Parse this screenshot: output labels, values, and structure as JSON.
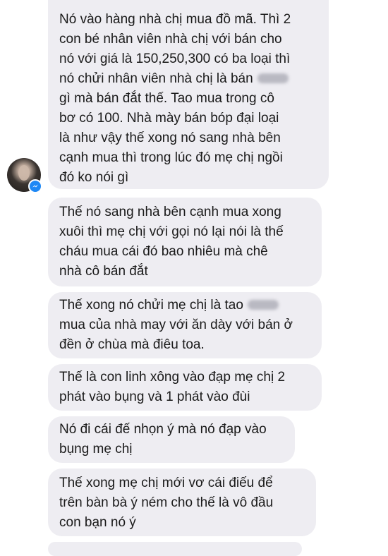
{
  "messages": [
    {
      "lines": [
        "Nó vào hàng nhà chị mua đồ mã. Thì 2",
        "con bé nhân viên nhà chị với bán cho",
        "nó với giá là 150,250,300 có ba loại thì",
        "nó chửi nhân viên nhà chị là bán",
        "gì mà bán đắt thế. Tao mua trong cô",
        "bơ có 100. Nhà mày bán bóp đại loại",
        "là như vậy thế xong nó sang nhà bên",
        "cạnh mua thì trong lúc đó mẹ chị ngồi",
        "đó ko nói gì"
      ]
    },
    {
      "lines": [
        "Thế nó sang nhà bên cạnh mua xong",
        "xuôi thì mẹ chị với gọi nó lại nói là thế",
        "cháu mua cái đó bao nhiêu mà chê",
        "nhà cô bán đắt"
      ]
    },
    {
      "lines": [
        "Thế xong nó chửi mẹ chị là tao",
        "mua của nhà may với ăn dày với bán ở",
        "đền ở chùa mà điêu toa."
      ]
    },
    {
      "lines": [
        "Thế là con linh xông vào đạp mẹ chị 2",
        "phát vào bụng và 1 phát vào đùi"
      ]
    },
    {
      "lines": [
        "Nó đi cái đế nhọn ý mà nó đạp vào",
        "bụng mẹ chị"
      ]
    },
    {
      "lines": [
        "Thế xong mẹ chị mới vơ cái điếu để",
        "trên bàn bà ý ném cho thế là vô đầu",
        "con bạn nó ý"
      ]
    }
  ],
  "icons": {
    "avatar": "sender-avatar",
    "badge": "messenger-badge-icon"
  },
  "colors": {
    "bubble_bg": "#eeedf2",
    "text": "#1a1a1a",
    "badge": "#1e88f5"
  }
}
